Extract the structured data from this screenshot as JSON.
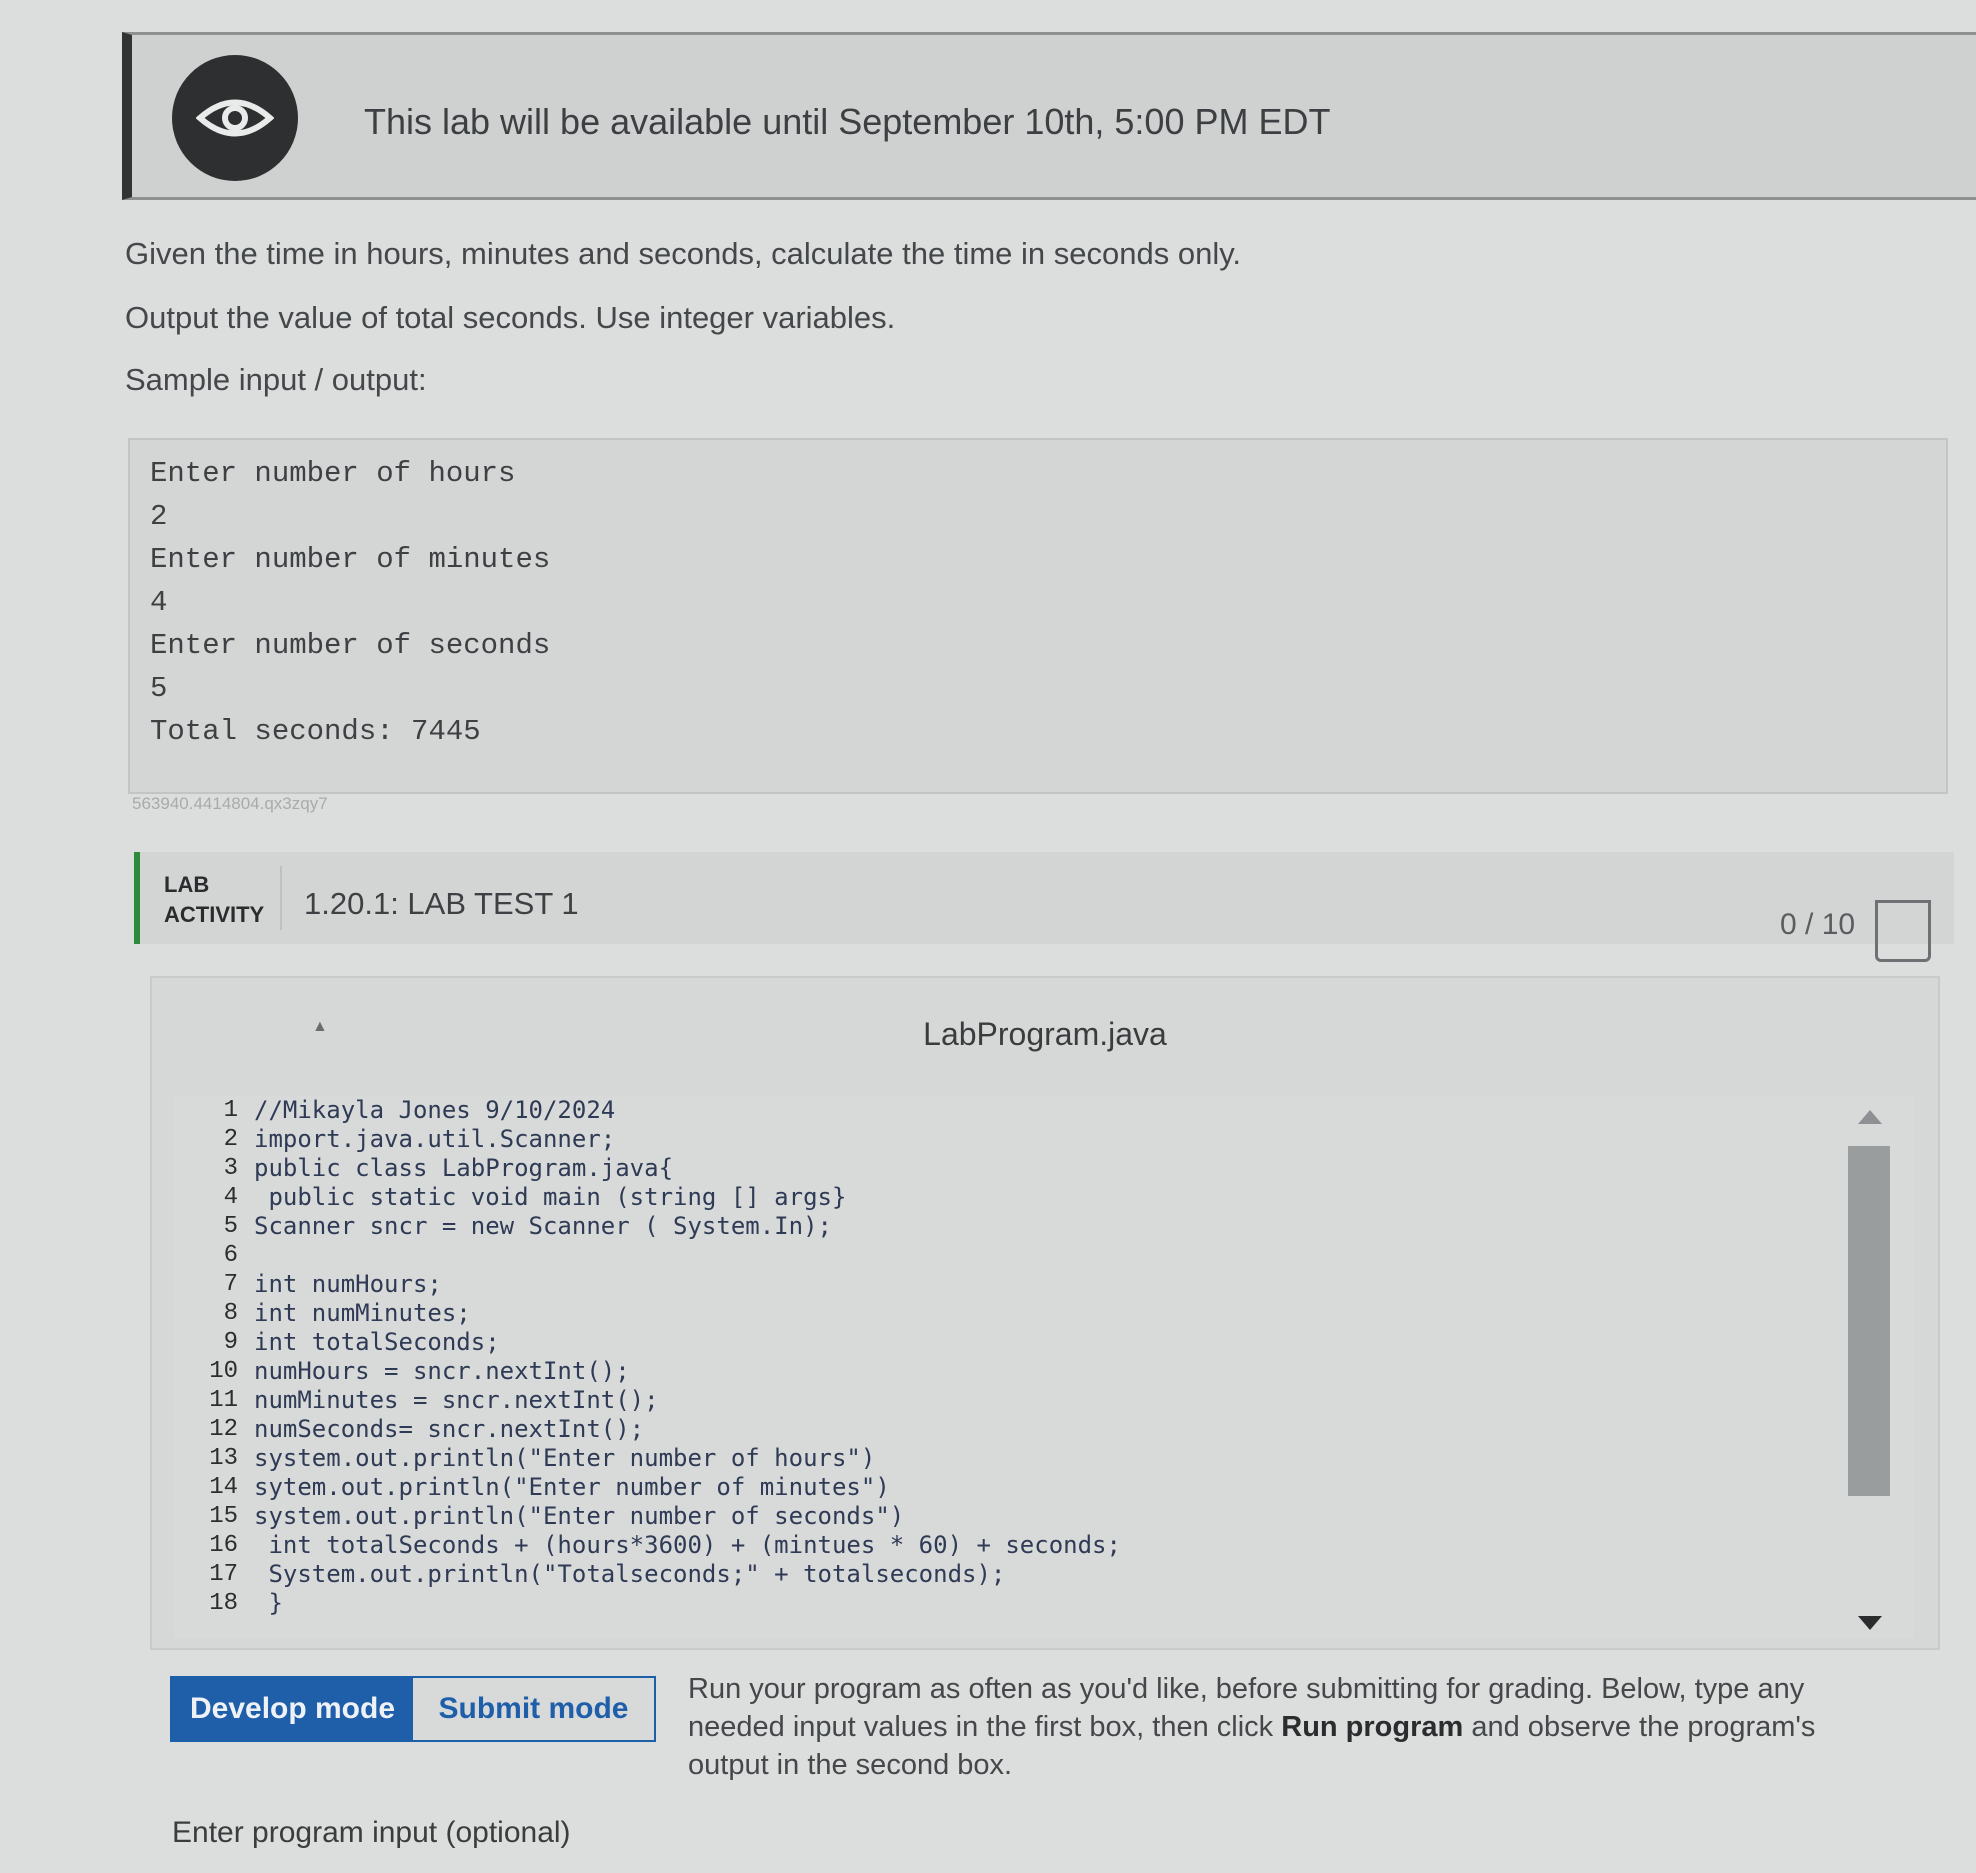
{
  "banner": {
    "icon": "eye-icon",
    "text": "This lab will be available until September 10th, 5:00 PM EDT"
  },
  "instructions": {
    "line1": "Given the time in hours, minutes and seconds, calculate the time in seconds only.",
    "line2": "Output the value of total seconds. Use integer variables.",
    "line3": "Sample input / output:"
  },
  "sample_io": [
    "Enter number of hours",
    "2",
    "Enter number of minutes",
    "4",
    "Enter number of seconds",
    "5",
    "Total seconds: 7445"
  ],
  "reference_id": "563940.4414804.qx3zqy7",
  "lab": {
    "tag_line1": "LAB",
    "tag_line2": "ACTIVITY",
    "title": "1.20.1: LAB TEST 1",
    "score": "0 / 10"
  },
  "editor": {
    "file_name": "LabProgram.java",
    "lines": [
      {
        "n": "1",
        "code": "//Mikayla Jones 9/10/2024"
      },
      {
        "n": "2",
        "code": "import.java.util.Scanner;"
      },
      {
        "n": "3",
        "code": "public class LabProgram.java{"
      },
      {
        "n": "4",
        "code": " public static void main (string [] args}"
      },
      {
        "n": "5",
        "code": "Scanner sncr = new Scanner ( System.In);"
      },
      {
        "n": "6",
        "code": ""
      },
      {
        "n": "7",
        "code": "int numHours;"
      },
      {
        "n": "8",
        "code": "int numMinutes;"
      },
      {
        "n": "9",
        "code": "int totalSeconds;"
      },
      {
        "n": "10",
        "code": "numHours = sncr.nextInt();"
      },
      {
        "n": "11",
        "code": "numMinutes = sncr.nextInt();"
      },
      {
        "n": "12",
        "code": "numSeconds= sncr.nextInt();"
      },
      {
        "n": "13",
        "code": "system.out.println(\"Enter number of hours\")"
      },
      {
        "n": "14",
        "code": "sytem.out.println(\"Enter number of minutes\")"
      },
      {
        "n": "15",
        "code": "system.out.println(\"Enter number of seconds\")"
      },
      {
        "n": "16",
        "code": " int totalSeconds + (hours*3600) + (mintues * 60) + seconds;"
      },
      {
        "n": "17",
        "code": " System.out.println(\"Totalseconds;\" + totalseconds);"
      },
      {
        "n": "18",
        "code": " }"
      }
    ]
  },
  "modes": {
    "develop": "Develop mode",
    "submit": "Submit mode",
    "help_prefix": "Run your program as often as you'd like, before submitting for grading. Below, type any needed input values in the first box, then click ",
    "help_bold": "Run program",
    "help_suffix": " and observe the program's output in the second box."
  },
  "input_label": "Enter program input (optional)",
  "colors": {
    "accent_blue": "#1f5faa",
    "lab_green": "#2e8b3c"
  }
}
